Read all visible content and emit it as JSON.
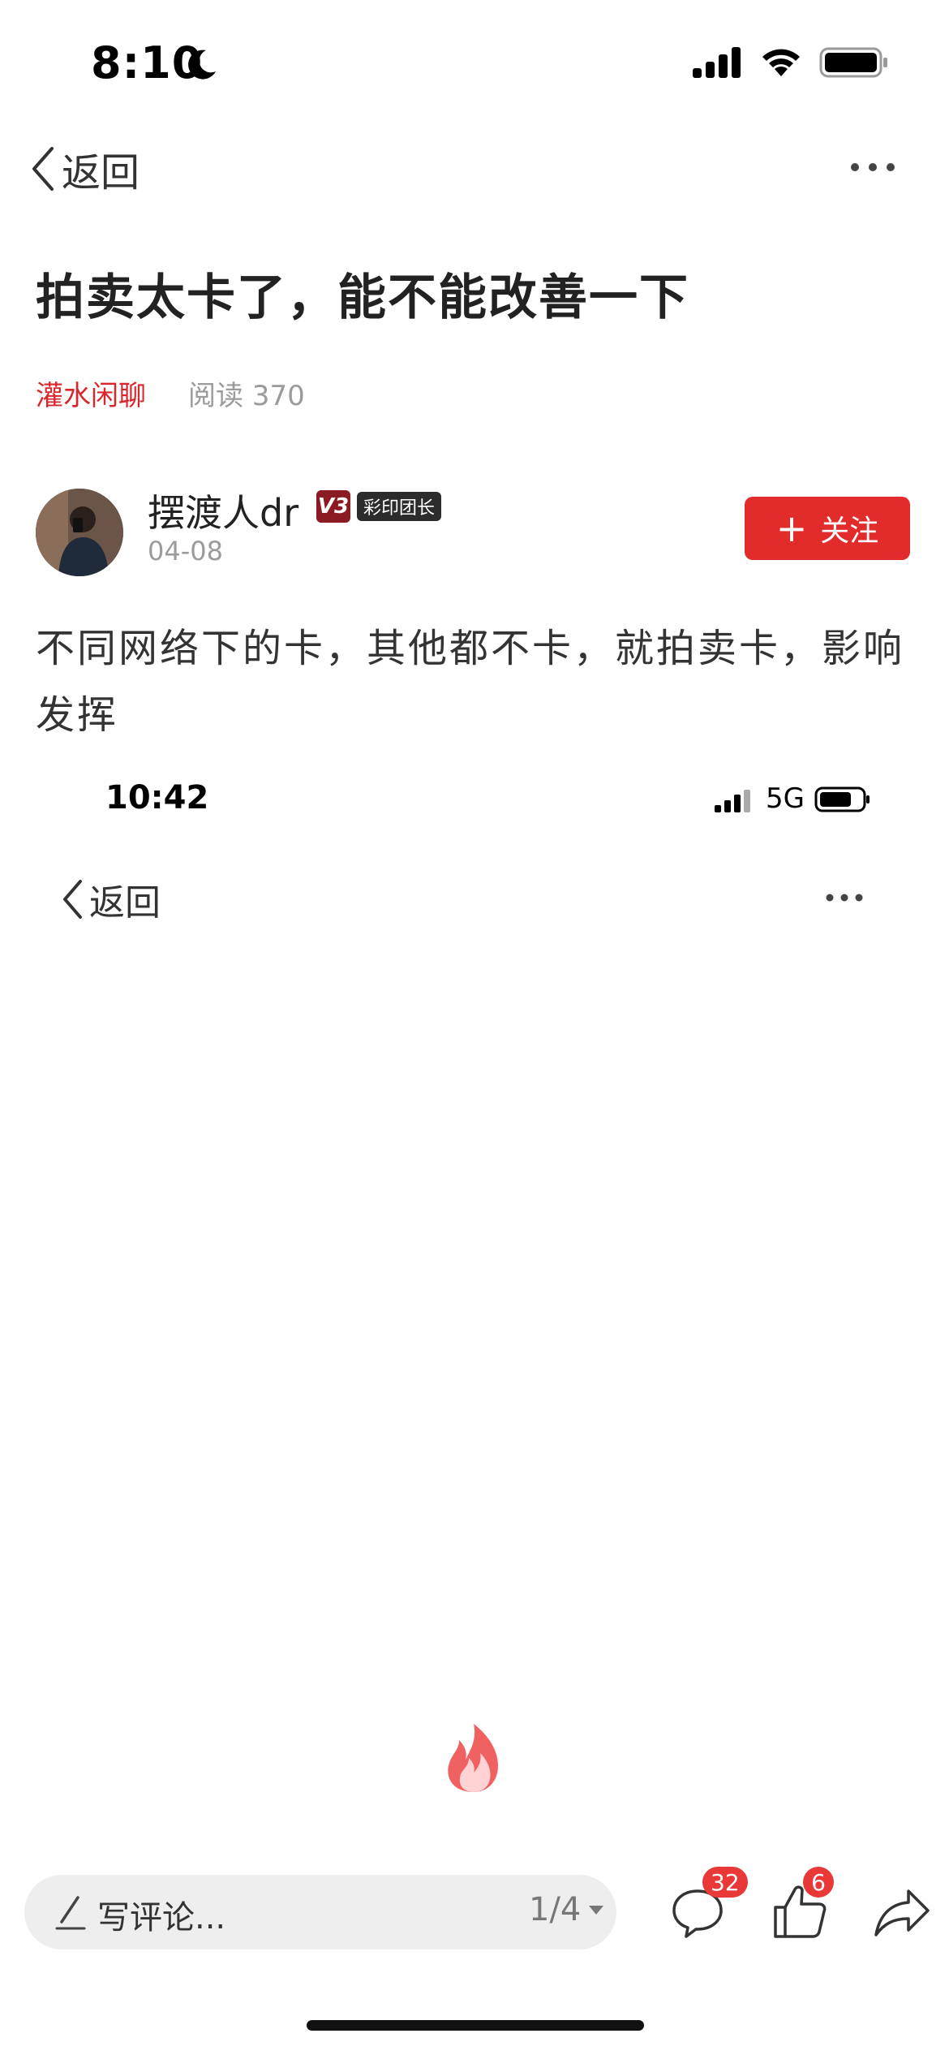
{
  "status_bar": {
    "time": "8:10",
    "icons": [
      "moon-icon",
      "signal-icon",
      "wifi-icon",
      "battery-icon"
    ]
  },
  "nav": {
    "back_label": "返回",
    "more_icon": "more-dots-icon"
  },
  "post": {
    "title": "拍卖太卡了，能不能改善一下",
    "category": "灌水闲聊",
    "read_count": "阅读 370",
    "body": "不同网络下的卡，其他都不卡，就拍卖卡，影响发挥"
  },
  "author": {
    "name": "摆渡人dr",
    "level_badge": "V3",
    "rank_badge": "彩印团长",
    "date": "04-08",
    "follow_label": "关注"
  },
  "embedded_screenshot": {
    "time": "10:42",
    "network": "5G",
    "back_label": "返回"
  },
  "bottom_bar": {
    "comment_placeholder": "写评论...",
    "page_indicator": "1/4",
    "comment_count": "32",
    "like_count": "6"
  },
  "colors": {
    "accent_red": "#e22b2b",
    "category_red": "#d8262c",
    "badge_red": "#e83838"
  }
}
